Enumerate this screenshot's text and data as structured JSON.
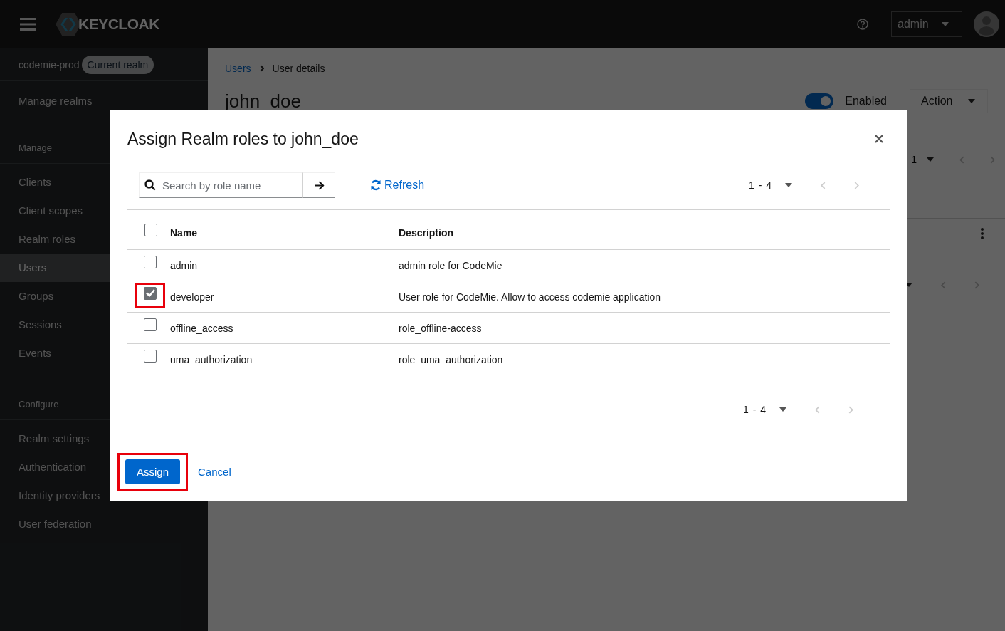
{
  "header": {
    "logo": "KEYCLOAK",
    "user_menu": "admin"
  },
  "sidebar": {
    "realm": "codemie-prod",
    "realm_badge": "Current realm",
    "top_link": "Manage realms",
    "sections": [
      {
        "title": "Manage",
        "items": [
          {
            "label": "Clients",
            "selected": false
          },
          {
            "label": "Client scopes",
            "selected": false
          },
          {
            "label": "Realm roles",
            "selected": false
          },
          {
            "label": "Users",
            "selected": true
          },
          {
            "label": "Groups",
            "selected": false
          },
          {
            "label": "Sessions",
            "selected": false
          },
          {
            "label": "Events",
            "selected": false
          }
        ]
      },
      {
        "title": "Configure",
        "items": [
          {
            "label": "Realm settings",
            "selected": false
          },
          {
            "label": "Authentication",
            "selected": false
          },
          {
            "label": "Identity providers",
            "selected": false
          },
          {
            "label": "User federation",
            "selected": false
          }
        ]
      }
    ]
  },
  "page": {
    "breadcrumbs": [
      {
        "label": "Users",
        "kind": "link"
      },
      {
        "label": "User details",
        "kind": "current"
      }
    ],
    "title": "john_doe",
    "enabled": {
      "label": "Enabled",
      "on": true
    },
    "action": "Action",
    "pager_fragment": "1"
  },
  "modal": {
    "title": "Assign Realm roles to john_doe",
    "search": {
      "placeholder": "Search by role name"
    },
    "refresh": "Refresh",
    "pagination_top": "1 - 4",
    "columns": [
      "Name",
      "Description"
    ],
    "select_all_checked": false,
    "rows": [
      {
        "name": "admin",
        "description": "admin role for CodeMie",
        "checked": false,
        "highlighted": false
      },
      {
        "name": "developer",
        "description": "User role for CodeMie. Allow to access codemie application",
        "checked": true,
        "highlighted": true
      },
      {
        "name": "offline_access",
        "description": "role_offline-access",
        "checked": false,
        "highlighted": false
      },
      {
        "name": "uma_authorization",
        "description": "role_uma_authorization",
        "checked": false,
        "highlighted": false
      }
    ],
    "pagination_bottom": "1 - 4",
    "assign": {
      "label": "Assign",
      "highlighted": true
    },
    "cancel": "Cancel"
  }
}
